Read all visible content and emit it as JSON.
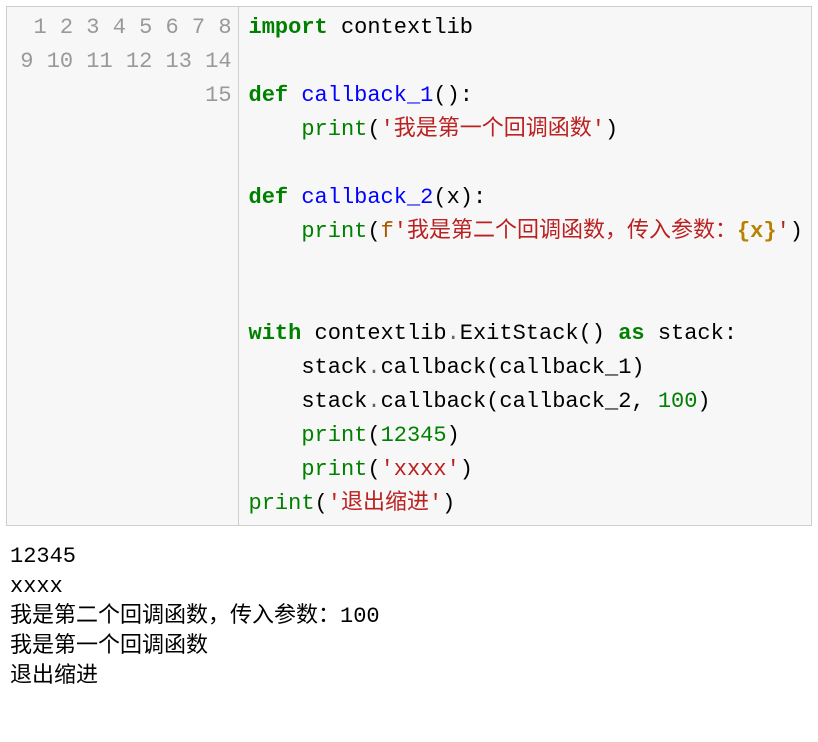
{
  "code": {
    "line_numbers": [
      "1",
      "2",
      "3",
      "4",
      "5",
      "6",
      "7",
      "8",
      "9",
      "10",
      "11",
      "12",
      "13",
      "14",
      "15"
    ],
    "lines": [
      {
        "indent": 0,
        "tokens": [
          {
            "t": "kw",
            "v": "import"
          },
          {
            "t": "plain",
            "v": " contextlib"
          }
        ]
      },
      {
        "indent": 0,
        "tokens": []
      },
      {
        "indent": 0,
        "tokens": [
          {
            "t": "kw",
            "v": "def"
          },
          {
            "t": "plain",
            "v": " "
          },
          {
            "t": "fn",
            "v": "callback_1"
          },
          {
            "t": "plain",
            "v": "():"
          }
        ]
      },
      {
        "indent": 1,
        "tokens": [
          {
            "t": "builtin",
            "v": "print"
          },
          {
            "t": "plain",
            "v": "("
          },
          {
            "t": "str",
            "v": "'我是第一个回调函数'"
          },
          {
            "t": "plain",
            "v": ")"
          }
        ]
      },
      {
        "indent": 0,
        "tokens": []
      },
      {
        "indent": 0,
        "tokens": [
          {
            "t": "kw",
            "v": "def"
          },
          {
            "t": "plain",
            "v": " "
          },
          {
            "t": "fn",
            "v": "callback_2"
          },
          {
            "t": "plain",
            "v": "(x):"
          }
        ]
      },
      {
        "indent": 1,
        "tokens": [
          {
            "t": "builtin",
            "v": "print"
          },
          {
            "t": "plain",
            "v": "("
          },
          {
            "t": "sp",
            "v": "f"
          },
          {
            "t": "str",
            "v": "'我是第二个回调函数，传入参数："
          },
          {
            "t": "interp",
            "v": "{x}"
          },
          {
            "t": "str",
            "v": "'"
          },
          {
            "t": "plain",
            "v": ")"
          }
        ]
      },
      {
        "indent": 0,
        "tokens": []
      },
      {
        "indent": 0,
        "tokens": []
      },
      {
        "indent": 0,
        "tokens": [
          {
            "t": "kw",
            "v": "with"
          },
          {
            "t": "plain",
            "v": " contextlib"
          },
          {
            "t": "op",
            "v": "."
          },
          {
            "t": "plain",
            "v": "ExitStack() "
          },
          {
            "t": "kw",
            "v": "as"
          },
          {
            "t": "plain",
            "v": " stack:"
          }
        ]
      },
      {
        "indent": 1,
        "tokens": [
          {
            "t": "plain",
            "v": "stack"
          },
          {
            "t": "op",
            "v": "."
          },
          {
            "t": "plain",
            "v": "callback(callback_1)"
          }
        ]
      },
      {
        "indent": 1,
        "tokens": [
          {
            "t": "plain",
            "v": "stack"
          },
          {
            "t": "op",
            "v": "."
          },
          {
            "t": "plain",
            "v": "callback(callback_2, "
          },
          {
            "t": "num",
            "v": "100"
          },
          {
            "t": "plain",
            "v": ")"
          }
        ]
      },
      {
        "indent": 1,
        "tokens": [
          {
            "t": "builtin",
            "v": "print"
          },
          {
            "t": "plain",
            "v": "("
          },
          {
            "t": "num",
            "v": "12345"
          },
          {
            "t": "plain",
            "v": ")"
          }
        ]
      },
      {
        "indent": 1,
        "tokens": [
          {
            "t": "builtin",
            "v": "print"
          },
          {
            "t": "plain",
            "v": "("
          },
          {
            "t": "str",
            "v": "'xxxx'"
          },
          {
            "t": "plain",
            "v": ")"
          }
        ]
      },
      {
        "indent": 0,
        "tokens": [
          {
            "t": "builtin",
            "v": "print"
          },
          {
            "t": "plain",
            "v": "("
          },
          {
            "t": "str",
            "v": "'退出缩进'"
          },
          {
            "t": "plain",
            "v": ")"
          }
        ]
      }
    ]
  },
  "output": {
    "lines": [
      "12345",
      "xxxx",
      "我是第二个回调函数，传入参数：100",
      "我是第一个回调函数",
      "退出缩进"
    ]
  },
  "indent_unit": "    "
}
